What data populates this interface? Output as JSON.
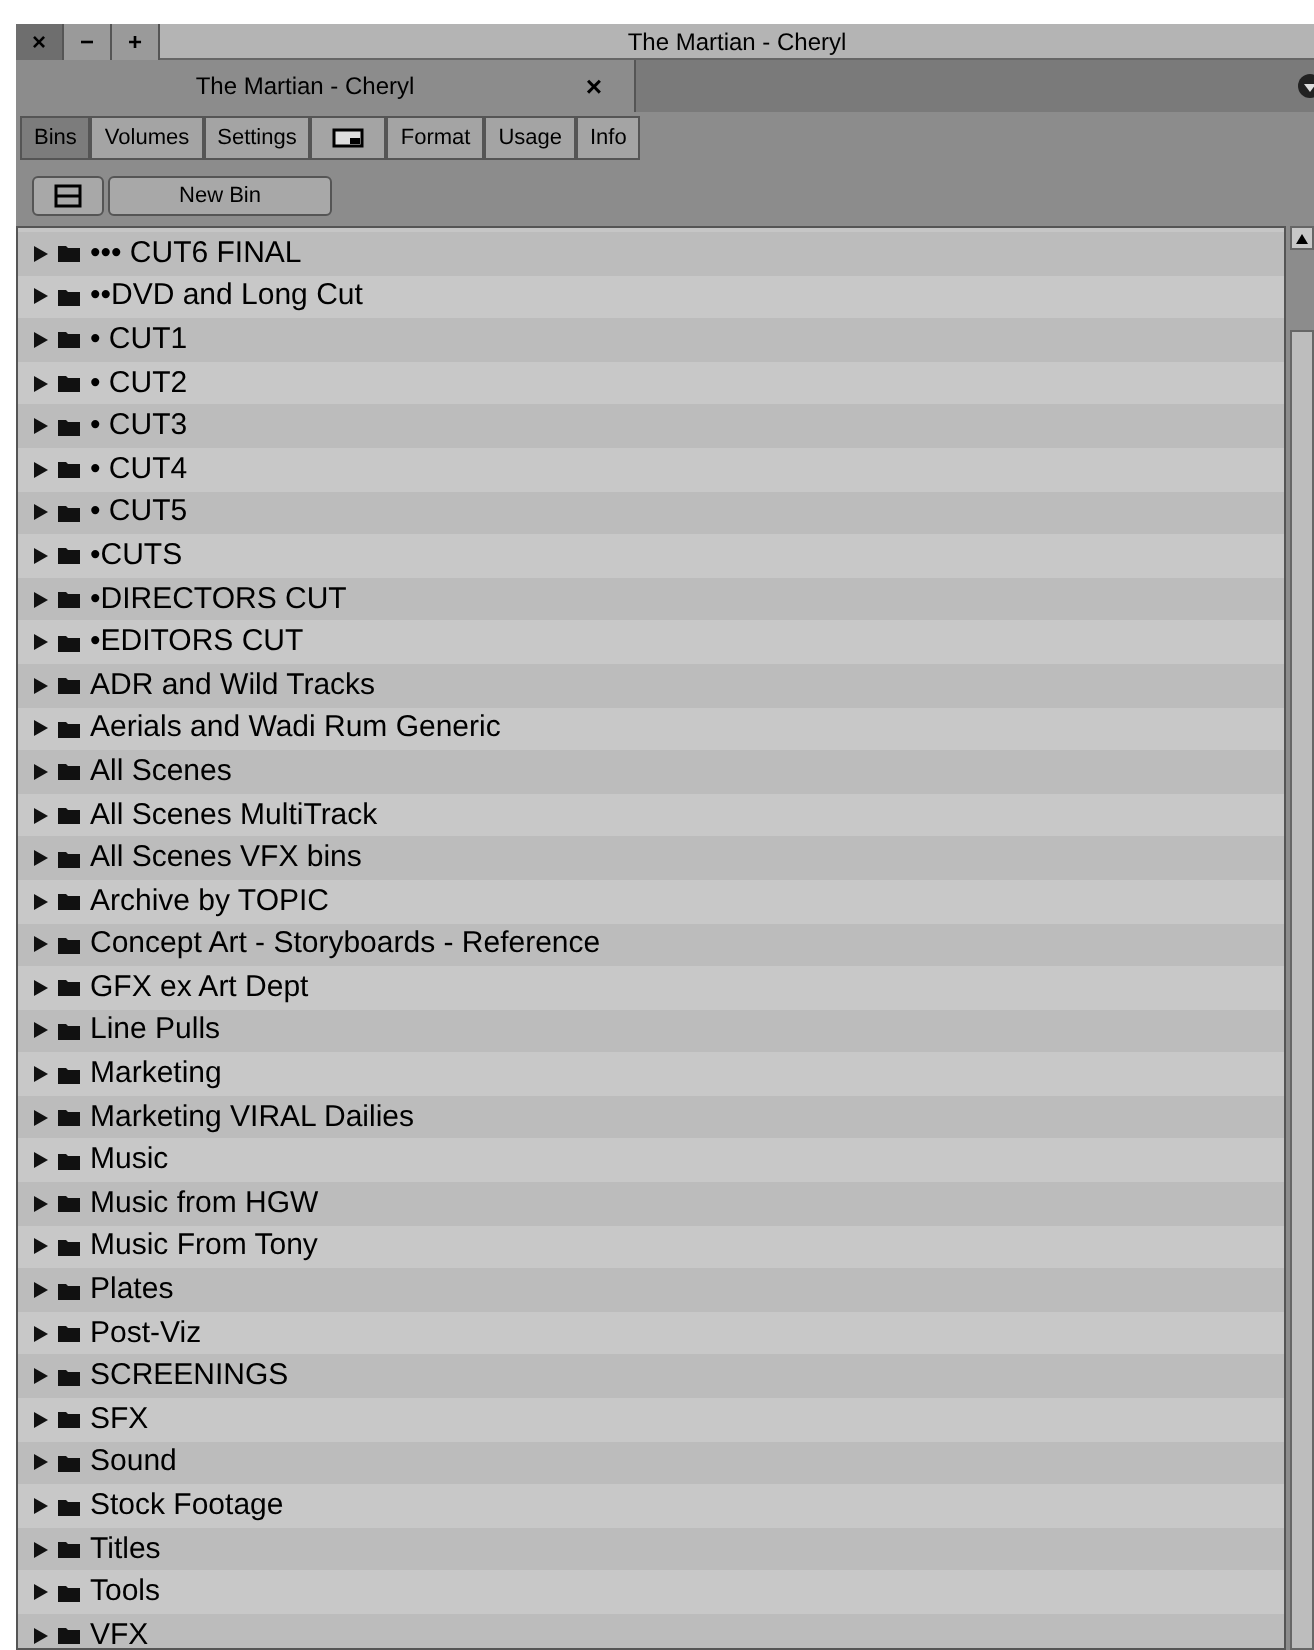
{
  "window": {
    "title": "The Martian - Cheryl"
  },
  "window_controls": [
    "×",
    "−",
    "+"
  ],
  "document_tab": {
    "label": "The Martian - Cheryl",
    "close": "×"
  },
  "tabs": [
    {
      "label": "Bins",
      "selected": true
    },
    {
      "label": "Volumes",
      "selected": false
    },
    {
      "label": "Settings",
      "selected": false
    },
    {
      "kind": "icon",
      "selected": false
    },
    {
      "label": "Format",
      "selected": false
    },
    {
      "label": "Usage",
      "selected": false
    },
    {
      "label": "Info",
      "selected": false
    }
  ],
  "new_bin_button": "New Bin",
  "bins": [
    {
      "name": "••• CUT6 FINAL"
    },
    {
      "name": "••DVD and Long Cut"
    },
    {
      "name": "• CUT1"
    },
    {
      "name": "• CUT2"
    },
    {
      "name": "• CUT3"
    },
    {
      "name": "• CUT4"
    },
    {
      "name": "• CUT5"
    },
    {
      "name": "•CUTS"
    },
    {
      "name": "•DIRECTORS CUT"
    },
    {
      "name": "•EDITORS CUT"
    },
    {
      "name": "ADR and Wild Tracks"
    },
    {
      "name": "Aerials and Wadi Rum Generic"
    },
    {
      "name": "All Scenes"
    },
    {
      "name": "All Scenes MultiTrack"
    },
    {
      "name": "All Scenes VFX bins"
    },
    {
      "name": "Archive by TOPIC"
    },
    {
      "name": "Concept Art - Storyboards - Reference"
    },
    {
      "name": "GFX ex Art Dept"
    },
    {
      "name": "Line Pulls"
    },
    {
      "name": "Marketing"
    },
    {
      "name": "Marketing VIRAL Dailies"
    },
    {
      "name": "Music"
    },
    {
      "name": "Music from HGW"
    },
    {
      "name": "Music From Tony"
    },
    {
      "name": "Plates"
    },
    {
      "name": "Post-Viz"
    },
    {
      "name": "SCREENINGS"
    },
    {
      "name": "SFX"
    },
    {
      "name": "Sound"
    },
    {
      "name": "Stock Footage"
    },
    {
      "name": "Titles"
    },
    {
      "name": "Tools"
    },
    {
      "name": "VFX"
    }
  ]
}
